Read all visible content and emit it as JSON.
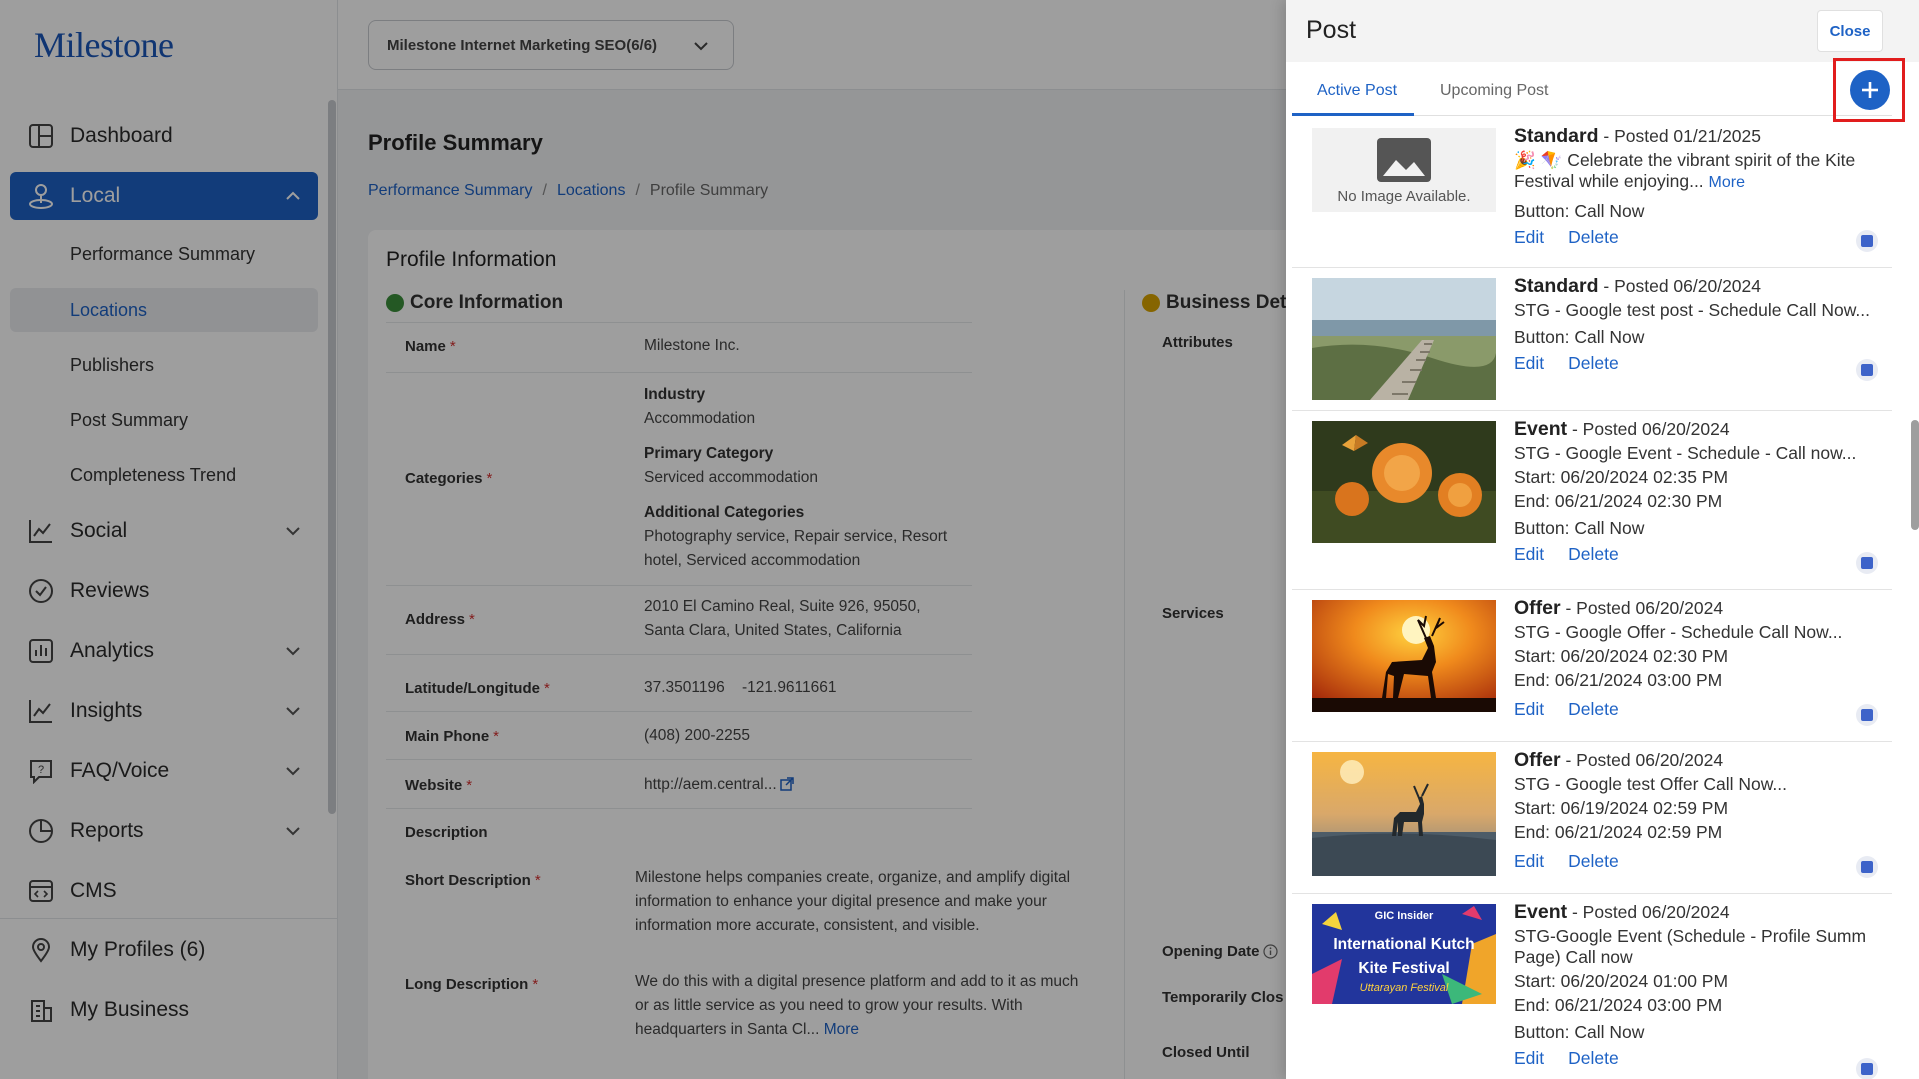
{
  "brand": {
    "logo": "Milestone",
    "accent": "#1e62c5"
  },
  "sidebar": {
    "items": [
      {
        "label": "Dashboard",
        "icon": "dashboard-icon"
      },
      {
        "label": "Local",
        "icon": "local-icon"
      },
      {
        "label": "Social",
        "icon": "social-icon"
      },
      {
        "label": "Reviews",
        "icon": "reviews-icon"
      },
      {
        "label": "Analytics",
        "icon": "analytics-icon"
      },
      {
        "label": "Insights",
        "icon": "insights-icon"
      },
      {
        "label": "FAQ/Voice",
        "icon": "faq-icon"
      },
      {
        "label": "Reports",
        "icon": "reports-icon"
      },
      {
        "label": "CMS",
        "icon": "cms-icon"
      },
      {
        "label": "My Profiles (6)",
        "icon": "location-pin-icon"
      },
      {
        "label": "My Business",
        "icon": "business-icon"
      }
    ],
    "local_sub": [
      "Performance Summary",
      "Locations",
      "Publishers",
      "Post Summary",
      "Completeness Trend"
    ]
  },
  "topbar": {
    "selector_value": "Milestone Internet Marketing SEO(6/6)"
  },
  "page": {
    "title": "Profile Summary",
    "breadcrumb": [
      "Performance Summary",
      "Locations",
      "Profile Summary"
    ],
    "card_title": "Profile Information",
    "core_heading": "Core Information",
    "business_heading": "Business Det",
    "fields": {
      "name_label": "Name",
      "name_value": "Milestone Inc.",
      "categories_label": "Categories",
      "industry_label": "Industry",
      "industry_value": "Accommodation",
      "primary_label": "Primary Category",
      "primary_value": "Serviced accommodation",
      "additional_label": "Additional Categories",
      "additional_value_1": "Photography service, Repair service, Resort",
      "additional_value_2": "hotel, Serviced accommodation",
      "address_label": "Address",
      "address_value_1": "2010 El Camino Real, Suite 926, 95050,",
      "address_value_2": "Santa Clara, United States, California",
      "latlng_label": "Latitude/Longitude",
      "lat_value": "37.3501196",
      "lng_value": "-121.9611661",
      "phone_label": "Main Phone",
      "phone_value": "(408) 200-2255",
      "website_label": "Website",
      "website_value": "http://aem.central...",
      "description_label": "Description",
      "short_desc_label": "Short Description",
      "short_desc_1": "Milestone helps companies create, organize, and amplify digital",
      "short_desc_2": "information to enhance your digital presence and make your",
      "short_desc_3": "information more accurate, consistent, and visible.",
      "long_desc_label": "Long Description",
      "long_desc_1": "We do this with a digital presence platform and add to it as much",
      "long_desc_2": "or as little service as you need to grow your results. With",
      "long_desc_3": "headquarters in Santa Cl...",
      "more": "More",
      "required_mark": "*"
    },
    "right_labels": [
      "Attributes",
      "Services",
      "Opening Date",
      "Temporarily Clos",
      "Closed Until"
    ]
  },
  "panel": {
    "title": "Post",
    "close": "Close",
    "tabs": [
      "Active Post",
      "Upcoming Post"
    ],
    "no_image": "No Image Available.",
    "edit": "Edit",
    "delete": "Delete",
    "more": "More",
    "posts": [
      {
        "type": "Standard",
        "posted": " - Posted 01/21/2025",
        "text_1": "🎉 🪁 Celebrate the vibrant spirit of the Kite",
        "text_2": "Festival while enjoying...",
        "button": "Button: Call Now"
      },
      {
        "type": "Standard",
        "posted": " - Posted 06/20/2024",
        "text_1": "STG - Google test post - Schedule Call Now...",
        "button": "Button: Call Now"
      },
      {
        "type": "Event",
        "posted": " - Posted 06/20/2024",
        "text_1": "STG - Google Event - Schedule - Call now...",
        "start": "Start: 06/20/2024 02:35 PM",
        "end": "End: 06/21/2024 02:30 PM",
        "button": "Button: Call Now"
      },
      {
        "type": "Offer",
        "posted": " - Posted 06/20/2024",
        "text_1": "STG - Google Offer - Schedule Call Now...",
        "start": "Start: 06/20/2024 02:30 PM",
        "end": "End: 06/21/2024 03:00 PM"
      },
      {
        "type": "Offer",
        "posted": " - Posted 06/20/2024",
        "text_1": "STG - Google test Offer Call Now...",
        "start": "Start: 06/19/2024 02:59 PM",
        "end": "End: 06/21/2024 02:59 PM"
      },
      {
        "type": "Event",
        "posted": " - Posted 06/20/2024",
        "text_1": "STG-Google Event (Schedule - Profile Summ",
        "text_2": "Page) Call now",
        "start": "Start: 06/20/2024 01:00 PM",
        "end": "End: 06/21/2024 03:00 PM",
        "button": "Button: Call Now"
      }
    ],
    "kite_banner": {
      "brand": "GIC",
      "sub": "Insider",
      "line1": "International Kutch",
      "line2": "Kite Festival",
      "line3": "Uttarayan Festival"
    }
  }
}
